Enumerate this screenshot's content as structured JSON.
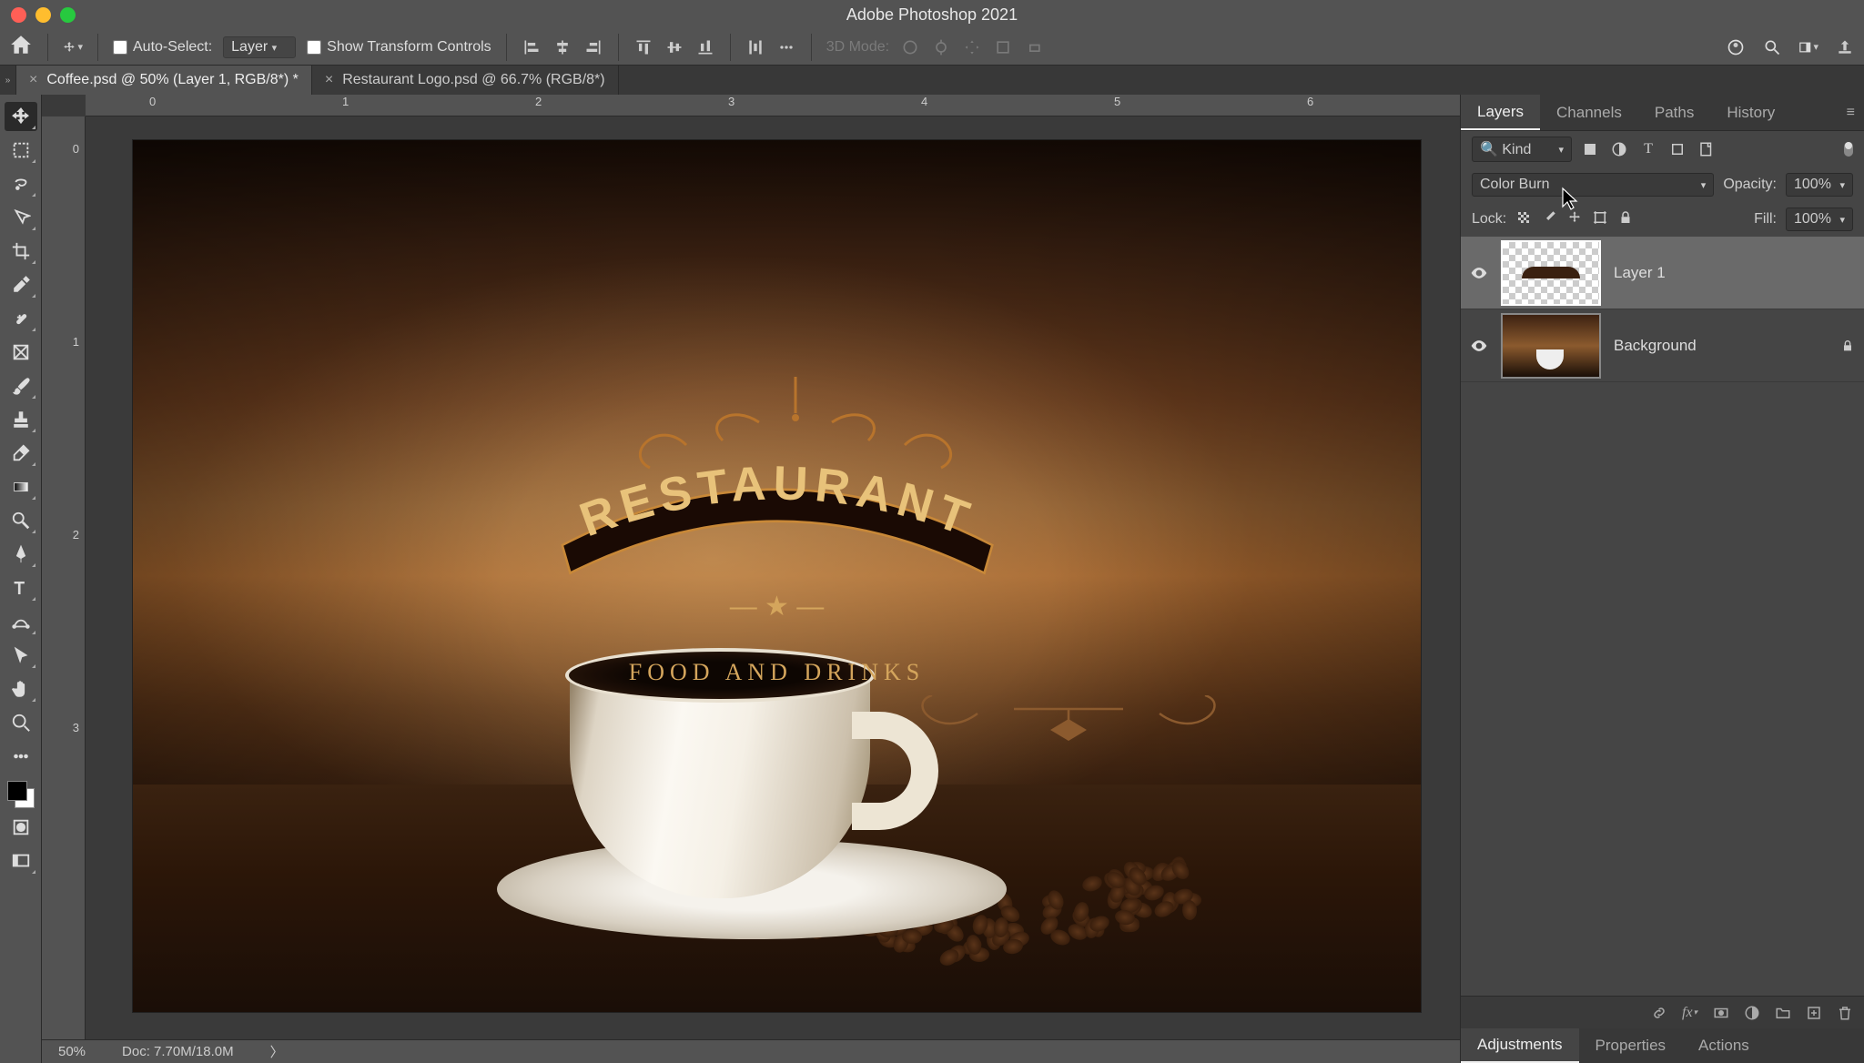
{
  "app": {
    "title": "Adobe Photoshop 2021"
  },
  "options": {
    "auto_select": "Auto-Select:",
    "auto_select_target": "Layer",
    "show_transform": "Show Transform Controls",
    "mode_3d": "3D Mode:"
  },
  "tabs": [
    {
      "title": "Coffee.psd @ 50% (Layer 1, RGB/8*) *",
      "active": true
    },
    {
      "title": "Restaurant Logo.psd @ 66.7% (RGB/8*)",
      "active": false
    }
  ],
  "ruler": {
    "h": [
      "0",
      "1",
      "2",
      "3",
      "4",
      "5",
      "6"
    ],
    "v": [
      "0",
      "1",
      "2",
      "3"
    ]
  },
  "canvas": {
    "logo_main": "RESTAURANT",
    "logo_sub": "FOOD AND DRINKS"
  },
  "status": {
    "zoom": "50%",
    "doc": "Doc: 7.70M/18.0M"
  },
  "panels": {
    "tabs": [
      "Layers",
      "Channels",
      "Paths",
      "History"
    ],
    "active_tab": "Layers",
    "filter_label": "Kind",
    "blend_mode": "Color Burn",
    "opacity_label": "Opacity:",
    "opacity_value": "100%",
    "lock_label": "Lock:",
    "fill_label": "Fill:",
    "fill_value": "100%",
    "bottom_tabs": [
      "Adjustments",
      "Properties",
      "Actions"
    ],
    "active_bottom": "Adjustments"
  },
  "layers": [
    {
      "name": "Layer 1",
      "selected": true,
      "locked": false,
      "transparent": true
    },
    {
      "name": "Background",
      "selected": false,
      "locked": true,
      "transparent": false
    }
  ]
}
